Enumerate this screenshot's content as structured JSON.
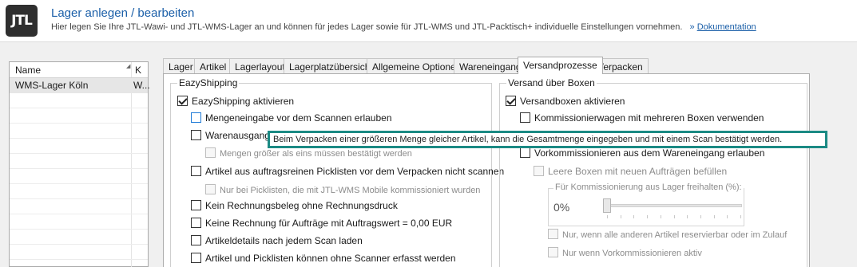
{
  "header": {
    "logo_text": "JTL",
    "title": "Lager anlegen / bearbeiten",
    "subtitle": "Hier legen Sie Ihre JTL-Wawi- und JTL-WMS-Lager an und können für jedes Lager sowie für JTL-WMS und JTL-Packtisch+ individuelle Einstellungen vornehmen.",
    "link_prefix": "»",
    "doc_link": "Dokumentation"
  },
  "grid": {
    "columns": [
      "Name",
      "K"
    ],
    "rows": [
      {
        "name": "WMS-Lager Köln",
        "k": "W..."
      }
    ]
  },
  "tabs": [
    "Lager",
    "Artikel",
    "Lagerlayout",
    "Lagerplatzübersicht",
    "Allgemeine Optionen",
    "Wareneingang",
    "Versandprozesse",
    "Verpacken"
  ],
  "active_tab": "Versandprozesse",
  "easy": {
    "title": "EazyShipping",
    "items": [
      {
        "label": "EazyShipping aktivieren",
        "checked": true
      },
      {
        "label": "Mengeneingabe vor dem Scannen erlauben",
        "checked": false
      },
      {
        "label": "Warenausgang",
        "checked": false
      },
      {
        "label": "Mengen größer als eins müssen bestätigt werden",
        "checked": false
      },
      {
        "label": "Artikel aus auftragsreinen Picklisten vor dem Verpacken nicht scannen",
        "checked": false
      },
      {
        "label": "Nur bei Picklisten, die mit JTL-WMS Mobile kommissioniert wurden",
        "checked": false
      },
      {
        "label": "Kein Rechnungsbeleg ohne Rechnungsdruck",
        "checked": false
      },
      {
        "label": "Keine Rechnung für Aufträge mit Auftragswert = 0,00 EUR",
        "checked": false
      },
      {
        "label": "Artikeldetails nach jedem Scan laden",
        "checked": false
      },
      {
        "label": "Artikel und Picklisten können ohne Scanner erfasst werden",
        "checked": false
      }
    ]
  },
  "boxes": {
    "title": "Versand über Boxen",
    "items": [
      {
        "label": "Versandboxen aktivieren",
        "checked": true
      },
      {
        "label": "Kommissionierwagen mit mehreren Boxen verwenden",
        "checked": false
      },
      {
        "label": "Vorkommissionieren aus dem Wareneingang erlauben",
        "checked": false
      },
      {
        "label": "Leere Boxen mit neuen Aufträgen befüllen",
        "checked": false
      },
      {
        "label": "Nur, wenn alle anderen Artikel reservierbar oder im Zulauf",
        "checked": false
      },
      {
        "label": "Nur wenn Vorkommissionieren aktiv",
        "checked": false
      }
    ],
    "reserve": {
      "title": "Für Kommissionierung aus Lager freihalten (%):",
      "value": "0%",
      "level": 0
    }
  },
  "tooltip": "Beim Verpacken einer größeren Menge gleicher Artikel, kann die Gesamtmenge eingegeben und mit einem Scan bestätigt werden."
}
